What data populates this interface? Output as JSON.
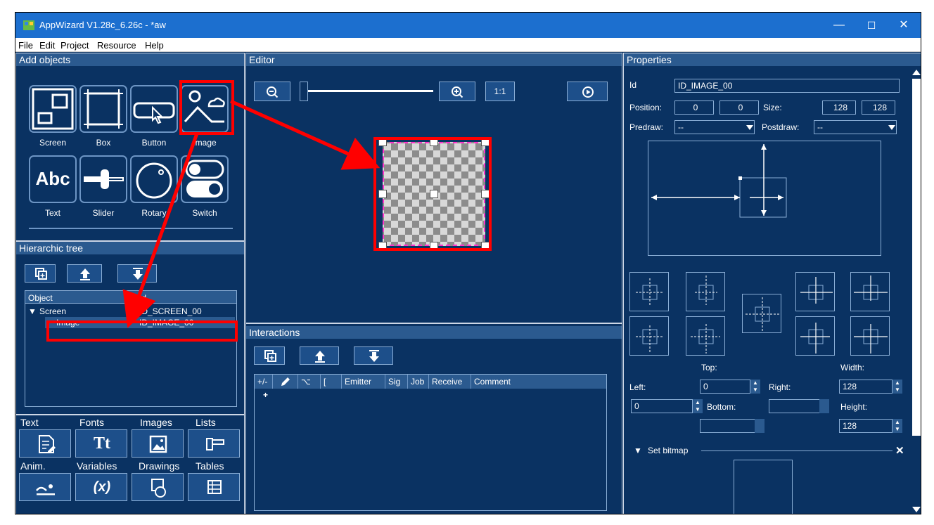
{
  "window": {
    "title": "AppWizard V1.28c_6.26c - *aw",
    "minimize": "—",
    "maximize": "☐",
    "close": "✕"
  },
  "menu": [
    "File",
    "Edit",
    "Project",
    "Resource",
    "Help"
  ],
  "add_objects": {
    "title": "Add objects",
    "tiles": [
      {
        "label": "Screen",
        "icon": "screen-icon"
      },
      {
        "label": "Box",
        "icon": "box-icon"
      },
      {
        "label": "Button",
        "icon": "button-icon"
      },
      {
        "label": "Image",
        "icon": "image-icon"
      },
      {
        "label": "Text",
        "icon": "text-icon",
        "glyph": "Abc"
      },
      {
        "label": "Slider",
        "icon": "slider-icon"
      },
      {
        "label": "Rotary",
        "icon": "rotary-icon"
      },
      {
        "label": "Switch",
        "icon": "switch-icon"
      }
    ]
  },
  "tree": {
    "title": "Hierarchic tree",
    "col_object": "Object",
    "col_id": "Id",
    "rows": [
      {
        "object": "Screen",
        "id": "ID_SCREEN_00",
        "arrow": "▼"
      },
      {
        "object": "Image",
        "id": "ID_IMAGE_00"
      }
    ]
  },
  "resources": {
    "tabs_top": [
      "Text",
      "Fonts",
      "Images",
      "Lists"
    ],
    "tabs_bottom": [
      "Anim.",
      "Variables",
      "Drawings",
      "Tables"
    ],
    "icons_top": [
      "text-resource-icon",
      "fonts-icon",
      "images-icon",
      "lists-icon"
    ],
    "icons_bottom": [
      "animation-icon",
      "variables-icon",
      "drawings-icon",
      "tables-icon"
    ],
    "fonts_glyph": "Tt",
    "variables_glyph": "(x)"
  },
  "editor": {
    "title": "Editor",
    "zoom_label": "1:1",
    "zoom": 1.0
  },
  "interactions": {
    "title": "Interactions",
    "columns": [
      "+/-",
      "",
      "⌥",
      "[",
      "Emitter",
      "Sig",
      "Job",
      "Receive",
      "Comment"
    ],
    "add_row": "+"
  },
  "properties": {
    "title": "Properties",
    "id_label": "Id",
    "id_value": "ID_IMAGE_00",
    "position_label": "Position:",
    "pos_x": "0",
    "pos_y": "0",
    "size_label": "Size:",
    "size_w": "128",
    "size_h": "128",
    "predraw_label": "Predraw:",
    "predraw_value": "--",
    "postdraw_label": "Postdraw:",
    "postdraw_value": "--",
    "top_label": "Top:",
    "top_value": "0",
    "width_label": "Width:",
    "width_value": "128",
    "left_label": "Left:",
    "left_value": "0",
    "right_label": "Right:",
    "bottom_label": "Bottom:",
    "height_label": "Height:",
    "height_value": "128",
    "bitmap_label": "Set bitmap",
    "bitmap_toggle": "▼",
    "bitmap_close": "✕"
  },
  "colors": {
    "bg": "#0a3262",
    "header": "#2b5a8f",
    "highlight": "#ff0000",
    "titlebar": "#1c6fcf"
  }
}
